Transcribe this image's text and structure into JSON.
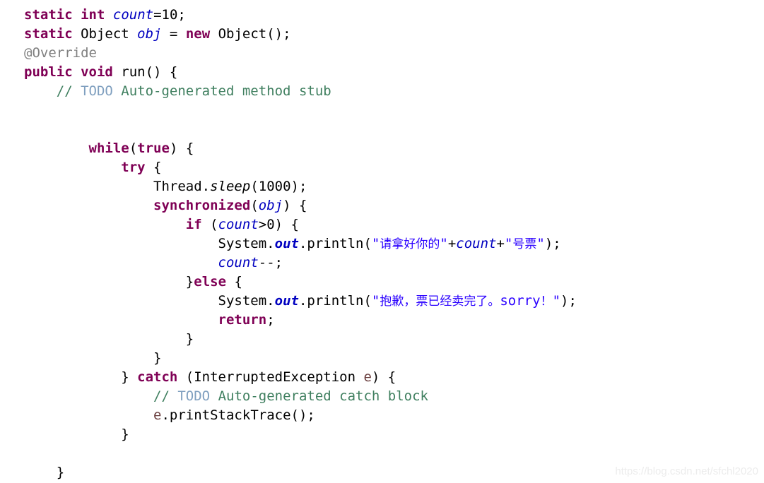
{
  "editor": {
    "name": "java-source-code-view",
    "background": "#ffffff",
    "font_size_px": 19,
    "line_height_px": 27,
    "theme": {
      "keyword": "#7f0055",
      "string": "#2a00ff",
      "field": "#0000c0",
      "comment": "#3f7f5f",
      "todo_tag": "#7f9fbf",
      "annotation": "#808080",
      "local_variable": "#6a3e3e",
      "plain_text": "#000000"
    }
  },
  "code": {
    "lines": [
      {
        "indent": 0,
        "tokens": [
          {
            "t": "static",
            "c": "tok-kw"
          },
          {
            "t": " ",
            "c": "tok-plain"
          },
          {
            "t": "int",
            "c": "tok-kw"
          },
          {
            "t": " ",
            "c": "tok-plain"
          },
          {
            "t": "count",
            "c": "tok-field"
          },
          {
            "t": "=10;",
            "c": "tok-plain"
          }
        ]
      },
      {
        "indent": 0,
        "tokens": [
          {
            "t": "static",
            "c": "tok-kw"
          },
          {
            "t": " Object ",
            "c": "tok-plain"
          },
          {
            "t": "obj",
            "c": "tok-field"
          },
          {
            "t": " = ",
            "c": "tok-plain"
          },
          {
            "t": "new",
            "c": "tok-kw"
          },
          {
            "t": " Object();",
            "c": "tok-plain"
          }
        ]
      },
      {
        "indent": 0,
        "tokens": [
          {
            "t": "@Override",
            "c": "tok-anno"
          }
        ]
      },
      {
        "indent": 0,
        "tokens": [
          {
            "t": "public",
            "c": "tok-kw"
          },
          {
            "t": " ",
            "c": "tok-plain"
          },
          {
            "t": "void",
            "c": "tok-kw"
          },
          {
            "t": " run() {",
            "c": "tok-plain"
          }
        ]
      },
      {
        "indent": 4,
        "tokens": [
          {
            "t": "// ",
            "c": "tok-comment"
          },
          {
            "t": "TODO",
            "c": "tok-todo"
          },
          {
            "t": " Auto-generated method stub",
            "c": "tok-comment"
          }
        ]
      },
      {
        "indent": 0,
        "tokens": []
      },
      {
        "indent": 0,
        "tokens": []
      },
      {
        "indent": 8,
        "tokens": [
          {
            "t": "while",
            "c": "tok-kw"
          },
          {
            "t": "(",
            "c": "tok-plain"
          },
          {
            "t": "true",
            "c": "tok-kw"
          },
          {
            "t": ") {",
            "c": "tok-plain"
          }
        ]
      },
      {
        "indent": 12,
        "tokens": [
          {
            "t": "try",
            "c": "tok-kw"
          },
          {
            "t": " {",
            "c": "tok-plain"
          }
        ]
      },
      {
        "indent": 16,
        "tokens": [
          {
            "t": "Thread.",
            "c": "tok-plain"
          },
          {
            "t": "sleep",
            "c": "tok-statm"
          },
          {
            "t": "(",
            "c": "tok-plain"
          },
          {
            "t": "1000",
            "c": "tok-num"
          },
          {
            "t": ");",
            "c": "tok-plain"
          }
        ]
      },
      {
        "indent": 16,
        "tokens": [
          {
            "t": "synchronized",
            "c": "tok-kw"
          },
          {
            "t": "(",
            "c": "tok-plain"
          },
          {
            "t": "obj",
            "c": "tok-field"
          },
          {
            "t": ") {",
            "c": "tok-plain"
          }
        ]
      },
      {
        "indent": 20,
        "tokens": [
          {
            "t": "if",
            "c": "tok-kw"
          },
          {
            "t": " (",
            "c": "tok-plain"
          },
          {
            "t": "count",
            "c": "tok-field"
          },
          {
            "t": ">0) {",
            "c": "tok-plain"
          }
        ]
      },
      {
        "indent": 24,
        "tokens": [
          {
            "t": "System.",
            "c": "tok-plain"
          },
          {
            "t": "out",
            "c": "tok-fieldb"
          },
          {
            "t": ".println(",
            "c": "tok-plain"
          },
          {
            "t": "\"",
            "c": "tok-str"
          },
          {
            "t": "请拿好你的",
            "c": "tok-str cjk"
          },
          {
            "t": "\"",
            "c": "tok-str"
          },
          {
            "t": "+",
            "c": "tok-plain"
          },
          {
            "t": "count",
            "c": "tok-field"
          },
          {
            "t": "+",
            "c": "tok-plain"
          },
          {
            "t": "\"",
            "c": "tok-str"
          },
          {
            "t": "号票",
            "c": "tok-str cjk"
          },
          {
            "t": "\"",
            "c": "tok-str"
          },
          {
            "t": ");",
            "c": "tok-plain"
          }
        ]
      },
      {
        "indent": 24,
        "tokens": [
          {
            "t": "count",
            "c": "tok-field"
          },
          {
            "t": "--;",
            "c": "tok-plain"
          }
        ]
      },
      {
        "indent": 20,
        "tokens": [
          {
            "t": "}",
            "c": "tok-plain"
          },
          {
            "t": "else",
            "c": "tok-kw"
          },
          {
            "t": " {",
            "c": "tok-plain"
          }
        ]
      },
      {
        "indent": 24,
        "tokens": [
          {
            "t": "System.",
            "c": "tok-plain"
          },
          {
            "t": "out",
            "c": "tok-fieldb"
          },
          {
            "t": ".println(",
            "c": "tok-plain"
          },
          {
            "t": "\"",
            "c": "tok-str"
          },
          {
            "t": "抱歉，票已经卖完了。",
            "c": "tok-str cjk"
          },
          {
            "t": "sorry",
            "c": "tok-str"
          },
          {
            "t": "！",
            "c": "tok-str cjk"
          },
          {
            "t": "\"",
            "c": "tok-str"
          },
          {
            "t": ");",
            "c": "tok-plain"
          }
        ]
      },
      {
        "indent": 24,
        "tokens": [
          {
            "t": "return",
            "c": "tok-kw"
          },
          {
            "t": ";",
            "c": "tok-plain"
          }
        ]
      },
      {
        "indent": 20,
        "tokens": [
          {
            "t": "}",
            "c": "tok-plain"
          }
        ]
      },
      {
        "indent": 16,
        "tokens": [
          {
            "t": "}",
            "c": "tok-plain"
          }
        ]
      },
      {
        "indent": 12,
        "tokens": [
          {
            "t": "} ",
            "c": "tok-plain"
          },
          {
            "t": "catch",
            "c": "tok-kw"
          },
          {
            "t": " (InterruptedException ",
            "c": "tok-plain"
          },
          {
            "t": "e",
            "c": "tok-local"
          },
          {
            "t": ") {",
            "c": "tok-plain"
          }
        ]
      },
      {
        "indent": 16,
        "tokens": [
          {
            "t": "// ",
            "c": "tok-comment"
          },
          {
            "t": "TODO",
            "c": "tok-todo"
          },
          {
            "t": " Auto-generated catch block",
            "c": "tok-comment"
          }
        ]
      },
      {
        "indent": 16,
        "tokens": [
          {
            "t": "e",
            "c": "tok-local"
          },
          {
            "t": ".printStackTrace();",
            "c": "tok-plain"
          }
        ]
      },
      {
        "indent": 12,
        "tokens": [
          {
            "t": "}",
            "c": "tok-plain"
          }
        ]
      },
      {
        "indent": 0,
        "tokens": []
      },
      {
        "indent": 4,
        "tokens": [
          {
            "t": "}",
            "c": "tok-plain"
          }
        ]
      }
    ]
  },
  "watermark": {
    "text": "https://blog.csdn.net/sfchl2020",
    "color": "#ececec"
  }
}
